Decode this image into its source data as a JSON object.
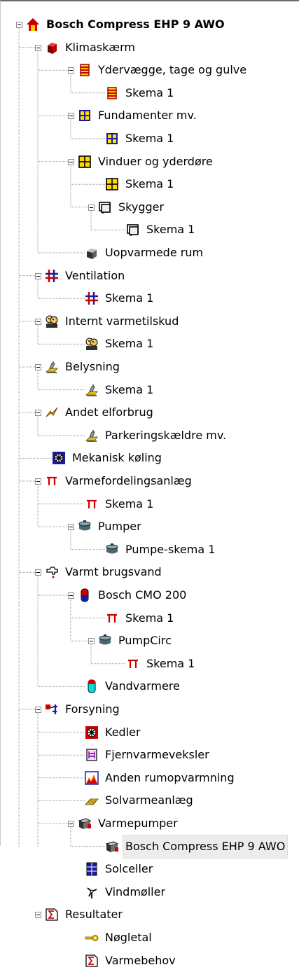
{
  "tree": {
    "root": {
      "label": "Bosch Compress EHP 9 AWO",
      "icon": "house-icon"
    },
    "nodes": [
      {
        "label": "Klimaskærm",
        "icon": "cube-red-icon"
      },
      {
        "label": "Ydervægge, tage og gulve",
        "icon": "wall-icon"
      },
      {
        "label": "Skema 1",
        "icon": "wall-icon"
      },
      {
        "label": "Fundamenter mv.",
        "icon": "grid-blue-icon"
      },
      {
        "label": "Skema 1",
        "icon": "grid-blue-icon"
      },
      {
        "label": "Vinduer og yderdøre",
        "icon": "window-icon"
      },
      {
        "label": "Skema 1",
        "icon": "window-icon"
      },
      {
        "label": "Skygger",
        "icon": "shade-icon"
      },
      {
        "label": "Skema 1",
        "icon": "shade-icon"
      },
      {
        "label": "Uopvarmede rum",
        "icon": "cube-gray-icon"
      },
      {
        "label": "Ventilation",
        "icon": "ventilation-icon"
      },
      {
        "label": "Skema 1",
        "icon": "ventilation-icon"
      },
      {
        "label": "Internt varmetilskud",
        "icon": "people-icon"
      },
      {
        "label": "Skema 1",
        "icon": "people-icon"
      },
      {
        "label": "Belysning",
        "icon": "lighting-icon"
      },
      {
        "label": "Skema 1",
        "icon": "lighting-icon"
      },
      {
        "label": "Andet elforbrug",
        "icon": "lightning-icon"
      },
      {
        "label": "Parkeringskældre mv.",
        "icon": "lighting-icon"
      },
      {
        "label": "Mekanisk køling",
        "icon": "cooling-icon"
      },
      {
        "label": "Varmefordelingsanlæg",
        "icon": "distribution-icon"
      },
      {
        "label": "Skema 1",
        "icon": "distribution-icon"
      },
      {
        "label": "Pumper",
        "icon": "pump-icon"
      },
      {
        "label": "Pumpe-skema 1",
        "icon": "pump-icon"
      },
      {
        "label": "Varmt brugsvand",
        "icon": "tap-icon"
      },
      {
        "label": "Bosch CMO 200",
        "icon": "tank-red-icon"
      },
      {
        "label": "Skema 1",
        "icon": "distribution-icon"
      },
      {
        "label": "PumpCirc",
        "icon": "pump-icon"
      },
      {
        "label": "Skema 1",
        "icon": "distribution-icon"
      },
      {
        "label": "Vandvarmere",
        "icon": "tank-cyan-icon"
      },
      {
        "label": "Forsyning",
        "icon": "supply-icon"
      },
      {
        "label": "Kedler",
        "icon": "boiler-icon"
      },
      {
        "label": "Fjernvarmeveksler",
        "icon": "exchanger-icon"
      },
      {
        "label": "Anden rumopvarmning",
        "icon": "chart-icon"
      },
      {
        "label": "Solvarmeanlæg",
        "icon": "solar-thermal-icon"
      },
      {
        "label": "Varmepumper",
        "icon": "heatpump-icon"
      },
      {
        "label": "Bosch Compress EHP 9 AWO",
        "icon": "heatpump-icon"
      },
      {
        "label": "Solceller",
        "icon": "solar-cell-icon"
      },
      {
        "label": "Vindmøller",
        "icon": "windmill-icon"
      },
      {
        "label": "Resultater",
        "icon": "results-icon"
      },
      {
        "label": "Nøgletal",
        "icon": "key-icon"
      },
      {
        "label": "Varmebehov",
        "icon": "results-icon"
      }
    ]
  }
}
